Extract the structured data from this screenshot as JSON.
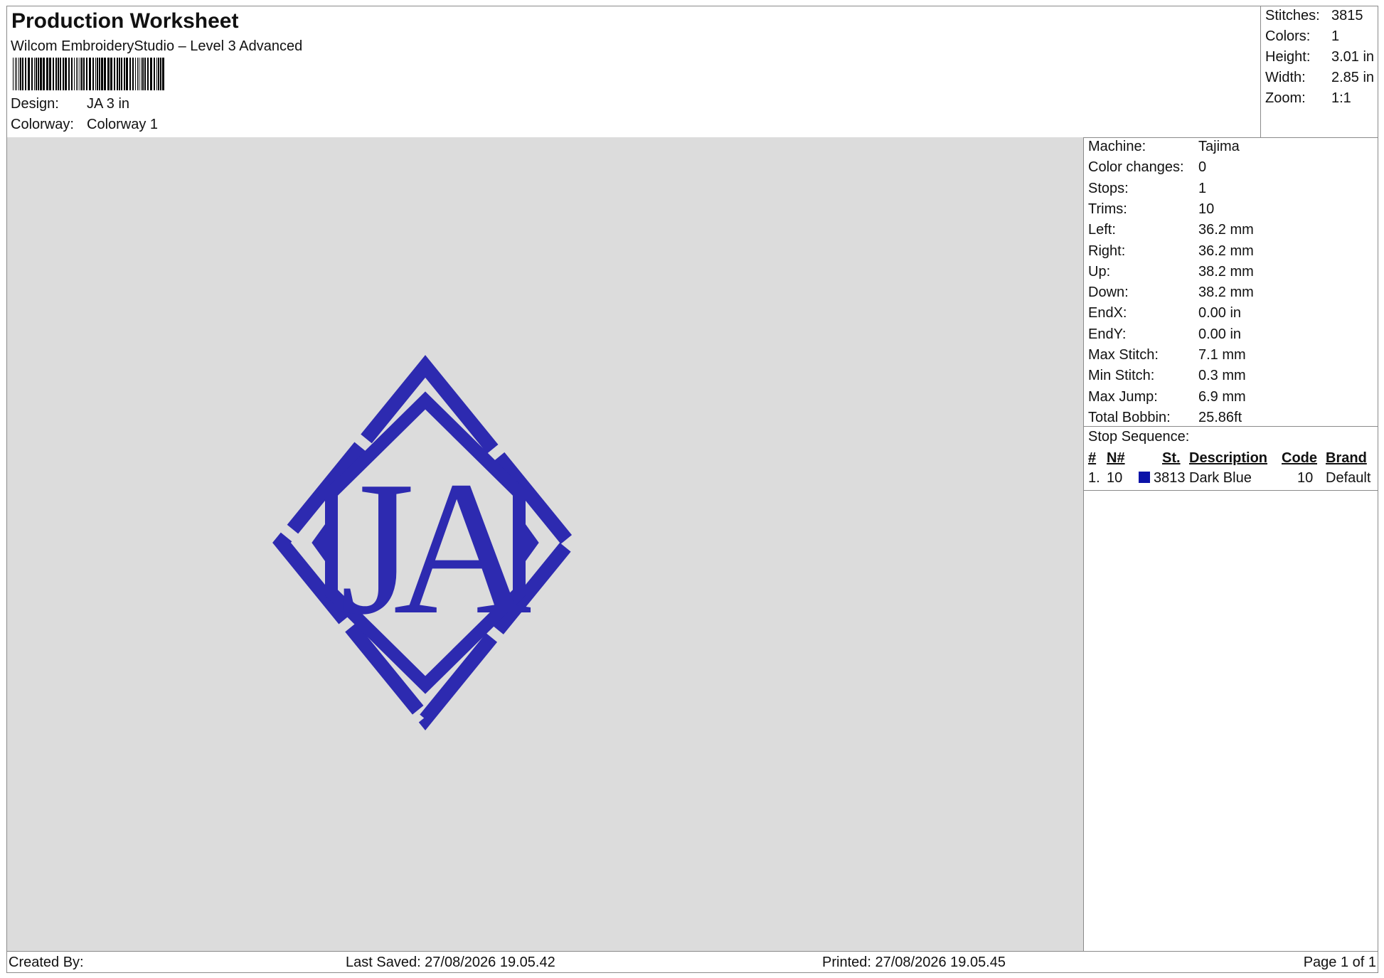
{
  "header": {
    "title": "Production Worksheet",
    "subtitle": "Wilcom EmbroideryStudio – Level 3 Advanced",
    "design_label": "Design:",
    "design_value": "JA 3 in",
    "colorway_label": "Colorway:",
    "colorway_value": "Colorway 1"
  },
  "summary": [
    {
      "label": "Stitches:",
      "value": "3815"
    },
    {
      "label": "Colors:",
      "value": "1"
    },
    {
      "label": "Height:",
      "value": "3.01 in"
    },
    {
      "label": "Width:",
      "value": "2.85 in"
    },
    {
      "label": "Zoom:",
      "value": "1:1"
    }
  ],
  "details": [
    {
      "label": "Machine:",
      "value": "Tajima"
    },
    {
      "label": "Color changes:",
      "value": "0"
    },
    {
      "label": "Stops:",
      "value": "1"
    },
    {
      "label": "Trims:",
      "value": "10"
    },
    {
      "label": "Left:",
      "value": "36.2 mm"
    },
    {
      "label": "Right:",
      "value": "36.2 mm"
    },
    {
      "label": "Up:",
      "value": "38.2 mm"
    },
    {
      "label": "Down:",
      "value": "38.2 mm"
    },
    {
      "label": "EndX:",
      "value": "0.00 in"
    },
    {
      "label": "EndY:",
      "value": "0.00 in"
    },
    {
      "label": "Max Stitch:",
      "value": "7.1 mm"
    },
    {
      "label": "Min Stitch:",
      "value": "0.3 mm"
    },
    {
      "label": "Max Jump:",
      "value": "6.9 mm"
    },
    {
      "label": "Total Bobbin:",
      "value": "25.86ft"
    }
  ],
  "stop_sequence": {
    "title": "Stop Sequence:",
    "columns": [
      "#",
      "N#",
      "St.",
      "Description",
      "Code",
      "Brand"
    ],
    "rows": [
      {
        "num": "1.",
        "needle": "10",
        "color": "#0b12a8",
        "stitches": "3813",
        "description": "Dark Blue",
        "code": "10",
        "brand": "Default"
      }
    ]
  },
  "design": {
    "monogram": "JA",
    "thread_color": "#2d2ab0"
  },
  "footer": {
    "created_by": "Created By:",
    "last_saved": "Last Saved: 27/08/2026 19.05.42",
    "printed": "Printed: 27/08/2026 19.05.45",
    "page": "Page 1 of 1"
  }
}
